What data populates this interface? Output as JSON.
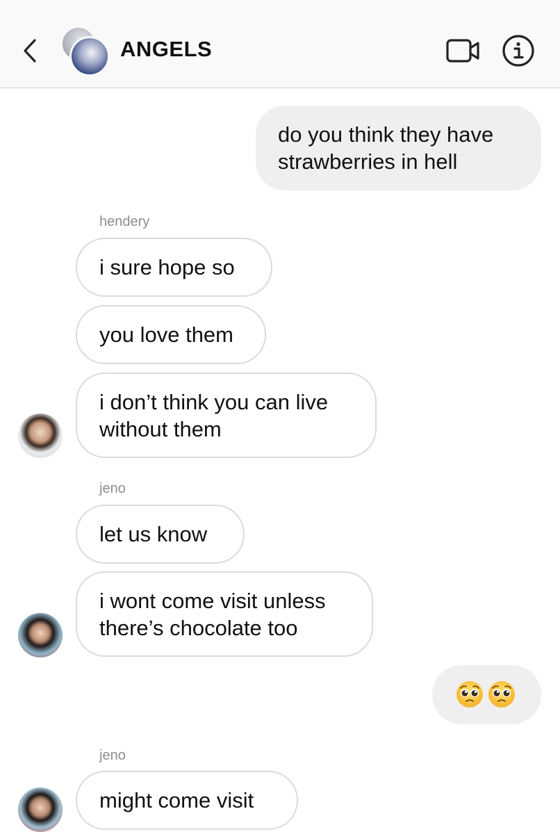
{
  "header": {
    "title": "ANGELS",
    "back_icon": "chevron-left-icon",
    "video_icon": "video-camera-icon",
    "info_icon": "info-icon"
  },
  "messages": [
    {
      "direction": "out",
      "lines": [
        "do you think they have",
        "strawberries in hell"
      ]
    },
    {
      "direction": "in",
      "sender": "hendery",
      "lines": [
        "i sure hope so"
      ]
    },
    {
      "direction": "in",
      "sender": "hendery",
      "lines": [
        "you love them"
      ]
    },
    {
      "direction": "in",
      "sender": "hendery",
      "lines": [
        "i don’t think you can live",
        "without them"
      ]
    },
    {
      "direction": "in",
      "sender": "jeno",
      "lines": [
        "let us know"
      ]
    },
    {
      "direction": "in",
      "sender": "jeno",
      "lines": [
        "i wont come visit unless",
        "there’s chocolate too"
      ]
    },
    {
      "direction": "out",
      "emoji": "pleading-face-emoji x2"
    },
    {
      "direction": "in",
      "sender": "jeno",
      "lines": [
        "might come visit"
      ]
    }
  ],
  "sender_labels": [
    "hendery",
    "jeno",
    "jeno"
  ],
  "colors": {
    "header_bg": "#f9f9f9",
    "outgoing_bubble": "#efefef",
    "incoming_border": "#dbdbdb",
    "sender_label": "#8e8e8e",
    "text": "#111111"
  }
}
